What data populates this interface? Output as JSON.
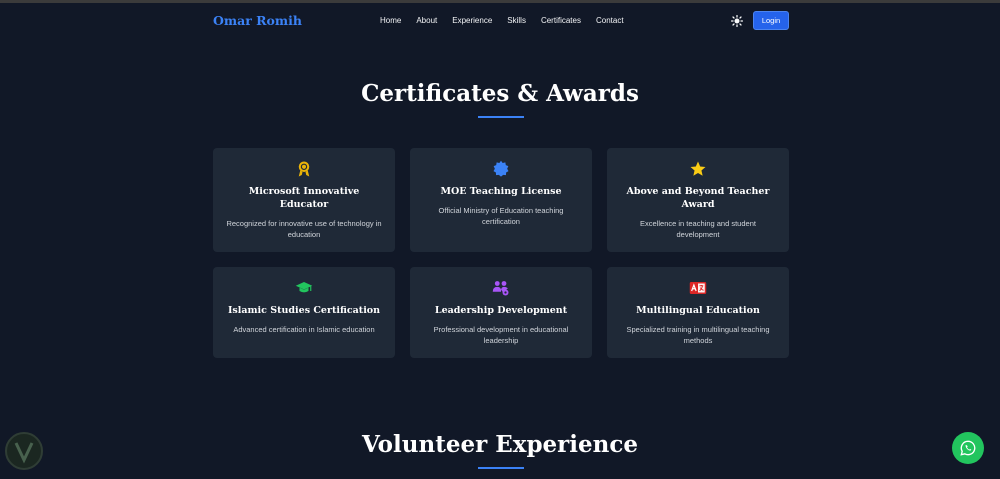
{
  "brand": "Omar Romih",
  "nav": {
    "links": [
      "Home",
      "About",
      "Experience",
      "Skills",
      "Certificates",
      "Contact"
    ],
    "login": "Login"
  },
  "sections": {
    "certificates_title": "Certificates & Awards",
    "volunteer_title": "Volunteer Experience"
  },
  "certificates": [
    {
      "icon": "medal-icon",
      "title": "Microsoft Innovative Educator",
      "desc": "Recognized for innovative use of technology in education"
    },
    {
      "icon": "certificate-badge-icon",
      "title": "MOE Teaching License",
      "desc": "Official Ministry of Education teaching certification"
    },
    {
      "icon": "star-icon",
      "title": "Above and Beyond Teacher Award",
      "desc": "Excellence in teaching and student development"
    },
    {
      "icon": "graduation-cap-icon",
      "title": "Islamic Studies Certification",
      "desc": "Advanced certification in Islamic education"
    },
    {
      "icon": "users-gear-icon",
      "title": "Leadership Development",
      "desc": "Professional development in educational leadership"
    },
    {
      "icon": "language-icon",
      "title": "Multilingual Education",
      "desc": "Specialized training in multilingual teaching methods"
    }
  ],
  "colors": {
    "accent": "#3b82f6",
    "bg": "#111827",
    "card": "#1f2937",
    "whatsapp": "#22c55e"
  }
}
